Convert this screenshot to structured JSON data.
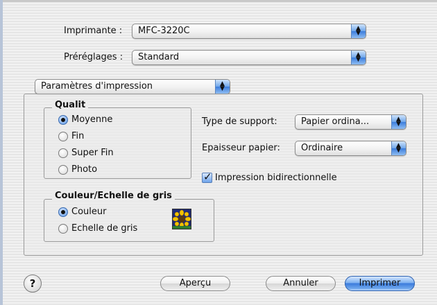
{
  "printer": {
    "label": "Imprimante :",
    "value": "MFC-3220C"
  },
  "presets": {
    "label": "Préréglages :",
    "value": "Standard"
  },
  "section": {
    "value": "Paramètres d'impression"
  },
  "quality": {
    "title": "Qualit",
    "options": [
      {
        "label": "Moyenne",
        "selected": true
      },
      {
        "label": "Fin",
        "selected": false
      },
      {
        "label": "Super Fin",
        "selected": false
      },
      {
        "label": "Photo",
        "selected": false
      }
    ]
  },
  "color": {
    "title": "Couleur/Echelle de gris",
    "options": [
      {
        "label": "Couleur",
        "selected": true
      },
      {
        "label": "Echelle de gris",
        "selected": false
      }
    ]
  },
  "media": {
    "label": "Type de support:",
    "value": "Papier ordina..."
  },
  "thickness": {
    "label": "Epaisseur papier:",
    "value": "Ordinaire"
  },
  "bidirectional": {
    "label": "Impression bidirectionnelle",
    "checked": true
  },
  "buttons": {
    "help": "?",
    "preview": "Aperçu",
    "cancel": "Annuler",
    "print": "Imprimer"
  },
  "colors": {
    "accent": "#3b7bdc",
    "background": "#ececec"
  }
}
